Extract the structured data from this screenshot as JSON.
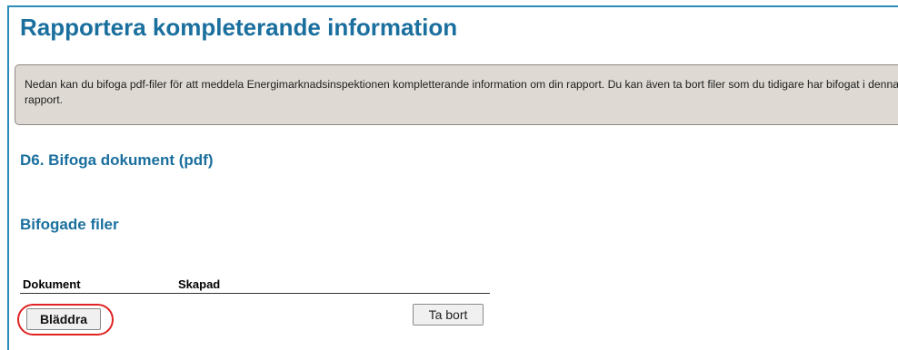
{
  "page": {
    "title": "Rapportera kompleterande information",
    "info_text": "Nedan kan du bifoga pdf-filer för att meddela Energimarknadsinspektionen kompletterande information om din rapport. Du kan även ta bort filer som du tidigare har bifogat i denna rapport."
  },
  "section": {
    "heading": "D6. Bifoga dokument (pdf)"
  },
  "attached_files": {
    "heading": "Bifogade filer",
    "columns": [
      "Dokument",
      "Skapad"
    ],
    "browse_label": "Bläddra",
    "remove_label": "Ta bort"
  },
  "colors": {
    "heading_blue": "#1a6f9e",
    "frame_blue": "#2a8ab8",
    "info_background": "#dedad3",
    "highlight_red": "#e02222"
  }
}
